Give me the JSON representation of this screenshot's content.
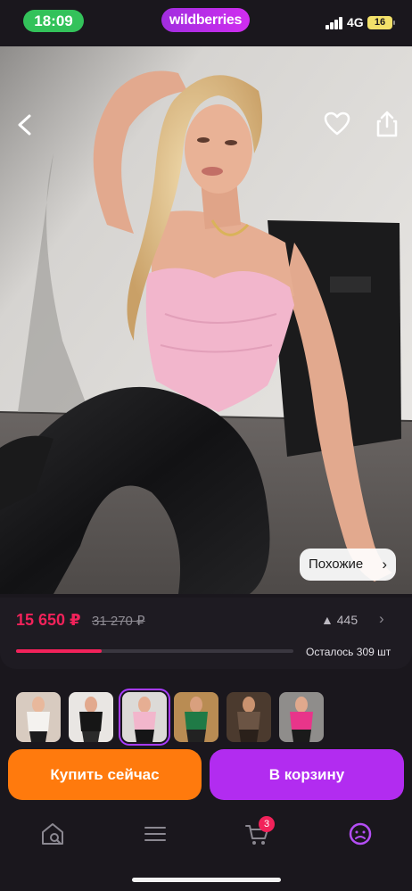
{
  "status_bar": {
    "time": "18:09",
    "brand": "wildberries",
    "network": "4G",
    "battery": "16"
  },
  "gallery": {
    "similar_label": "Похожие",
    "dot_count": 5,
    "active_dot": 0
  },
  "price": {
    "current": "15 650 ₽",
    "old": "31 270 ₽",
    "rank": "445",
    "remaining": "Осталось 309 шт",
    "progress_fraction": 0.31
  },
  "actions": {
    "buy_now": "Купить сейчас",
    "add_to_cart": "В корзину"
  },
  "nav": {
    "cart_count": "3"
  },
  "colors": {
    "accent_price": "#f2225a",
    "buy": "#ff7a0d",
    "cart": "#b22cf0"
  }
}
